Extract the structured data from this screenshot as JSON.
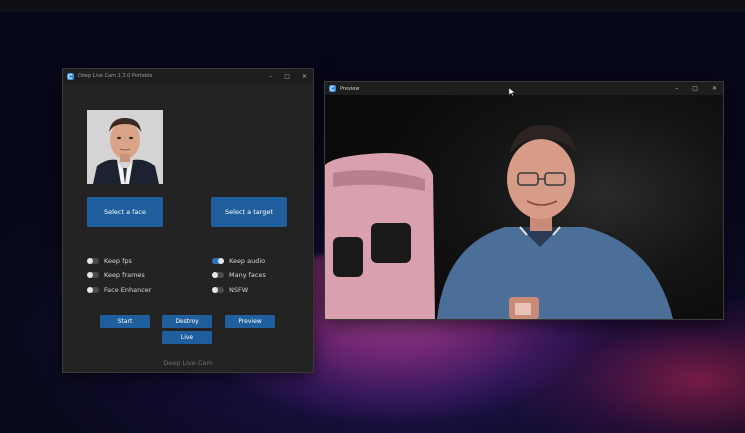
{
  "colors": {
    "accent_button": "#1f5f9e",
    "toggle_on": "#2a73c0",
    "window_bg": "#232323"
  },
  "main_window": {
    "title": "Deep Live Cam 1.3.0 Portable",
    "controls": {
      "minimize": "–",
      "maximize": "□",
      "close": "✕"
    },
    "face_image_alt": "source face image",
    "select_face_label": "Select a face",
    "select_target_label": "Select a target",
    "options_left": [
      {
        "label": "Keep fps",
        "on": false
      },
      {
        "label": "Keep frames",
        "on": false
      },
      {
        "label": "Face Enhancer",
        "on": false
      }
    ],
    "options_right": [
      {
        "label": "Keep audio",
        "on": true
      },
      {
        "label": "Many faces",
        "on": false
      },
      {
        "label": "NSFW",
        "on": false
      }
    ],
    "buttons": {
      "start": "Start",
      "destroy": "Destroy",
      "preview": "Preview",
      "live": "Live"
    },
    "footer": "Deep Live Cam"
  },
  "preview_window": {
    "title": "Preview",
    "controls": {
      "minimize": "–",
      "maximize": "□",
      "close": "✕"
    }
  }
}
